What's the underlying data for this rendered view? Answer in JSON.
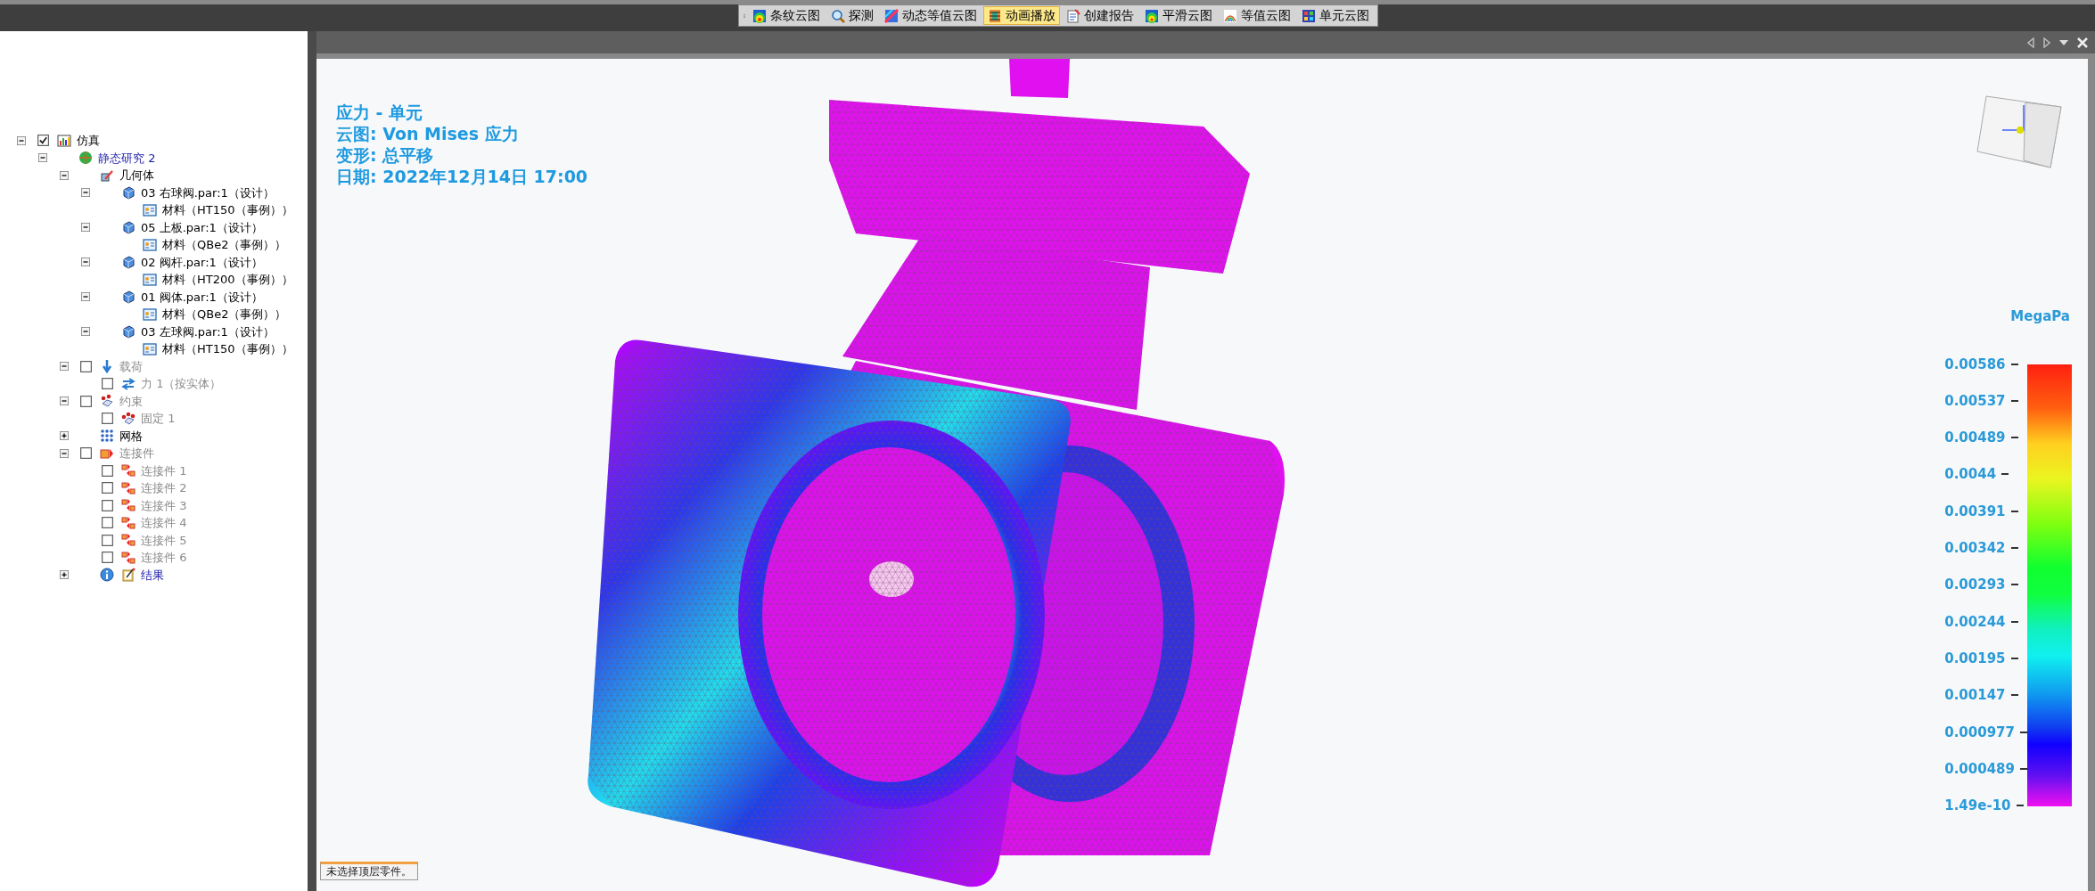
{
  "toolbar": [
    {
      "kind": "fringe",
      "label": "条纹云图",
      "selected": false
    },
    {
      "kind": "probe",
      "label": "探测",
      "selected": false
    },
    {
      "kind": "dynamic",
      "label": "动态等值云图",
      "selected": false
    },
    {
      "kind": "animate",
      "label": "动画播放",
      "selected": true
    },
    {
      "kind": "report",
      "label": "创建报告",
      "selected": false
    },
    {
      "kind": "smooth",
      "label": "平滑云图",
      "selected": false
    },
    {
      "kind": "contour",
      "label": "等值云图",
      "selected": false
    },
    {
      "kind": "element",
      "label": "单元云图",
      "selected": false
    }
  ],
  "tree": [
    {
      "kind": "simulation",
      "label": "仿真",
      "expanded": true,
      "checked": true,
      "disabled": false,
      "children": [
        {
          "kind": "study",
          "label": "静态研究 2",
          "expanded": true,
          "disabled": false,
          "children": [
            {
              "kind": "geometry",
              "label": "几何体",
              "expanded": true,
              "disabled": false,
              "children": [
                {
                  "kind": "part",
                  "label": "03 右球阀.par:1（设计）",
                  "expanded": true,
                  "disabled": false,
                  "children": [
                    {
                      "kind": "material",
                      "label": "材料（HT150（事例））",
                      "disabled": false
                    }
                  ]
                },
                {
                  "kind": "part",
                  "label": "05 上板.par:1（设计）",
                  "expanded": true,
                  "disabled": false,
                  "children": [
                    {
                      "kind": "material",
                      "label": "材料（QBe2（事例））",
                      "disabled": false
                    }
                  ]
                },
                {
                  "kind": "part",
                  "label": "02 阀杆.par:1（设计）",
                  "expanded": true,
                  "disabled": false,
                  "children": [
                    {
                      "kind": "material",
                      "label": "材料（HT200（事例））",
                      "disabled": false
                    }
                  ]
                },
                {
                  "kind": "part",
                  "label": "01 阀体.par:1（设计）",
                  "expanded": true,
                  "disabled": false,
                  "children": [
                    {
                      "kind": "material",
                      "label": "材料（QBe2（事例））",
                      "disabled": false
                    }
                  ]
                },
                {
                  "kind": "part",
                  "label": "03 左球阀.par:1（设计）",
                  "expanded": true,
                  "disabled": false,
                  "children": [
                    {
                      "kind": "material",
                      "label": "材料（HT150（事例））",
                      "disabled": false
                    }
                  ]
                }
              ]
            },
            {
              "kind": "loads",
              "label": "载荷",
              "expanded": true,
              "checked": false,
              "disabled": true,
              "children": [
                {
                  "kind": "load",
                  "label": "力 1（按实体）",
                  "checked": false,
                  "disabled": true
                }
              ]
            },
            {
              "kind": "constraints",
              "label": "约束",
              "expanded": true,
              "checked": false,
              "disabled": true,
              "children": [
                {
                  "kind": "constraint",
                  "label": "固定 1",
                  "checked": false,
                  "disabled": true
                }
              ]
            },
            {
              "kind": "mesh",
              "label": "网格",
              "expanded": false,
              "disabled": false
            },
            {
              "kind": "connectors",
              "label": "连接件",
              "expanded": true,
              "checked": false,
              "disabled": true,
              "children": [
                {
                  "kind": "connector",
                  "label": "连接件 1",
                  "checked": false,
                  "disabled": true
                },
                {
                  "kind": "connector",
                  "label": "连接件 2",
                  "checked": false,
                  "disabled": true
                },
                {
                  "kind": "connector",
                  "label": "连接件 3",
                  "checked": false,
                  "disabled": true
                },
                {
                  "kind": "connector",
                  "label": "连接件 4",
                  "checked": false,
                  "disabled": true
                },
                {
                  "kind": "connector",
                  "label": "连接件 5",
                  "checked": false,
                  "disabled": true
                },
                {
                  "kind": "connector",
                  "label": "连接件 6",
                  "checked": false,
                  "disabled": true
                }
              ]
            },
            {
              "kind": "results",
              "label": "结果",
              "expanded": false,
              "disabled": false
            }
          ]
        }
      ]
    }
  ],
  "annotation": [
    "应力 - 单元",
    "云图: Von Mises 应力",
    "变形: 总平移",
    "日期: 2022年12月14日  17:00"
  ],
  "legend": {
    "unit": "MegaPa",
    "ticks": [
      "0.00586",
      "0.00537",
      "0.00489",
      "0.0044",
      "0.00391",
      "0.00342",
      "0.00293",
      "0.00244",
      "0.00195",
      "0.00147",
      "0.000977",
      "0.000489",
      "1.49e-10"
    ]
  },
  "status_message": "未选择顶层零件。"
}
